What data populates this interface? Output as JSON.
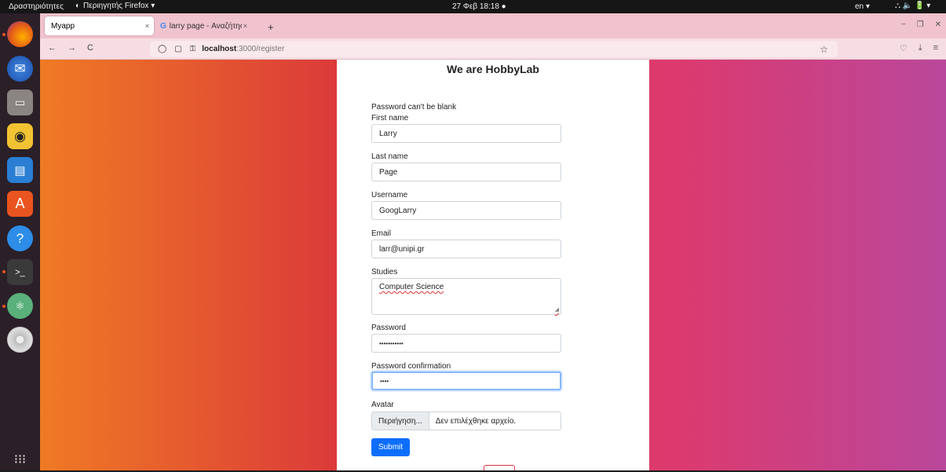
{
  "system_bar": {
    "activities": "Δραστηριότητες",
    "app_menu": "Περιηγητής Firefox ▾",
    "clock": "27 Φεβ 18:18 ●",
    "language": "en ▾",
    "tray": "⛬ 🔈 🔋 ▾"
  },
  "dock": {
    "items": [
      "firefox-icon",
      "thunderbird-icon",
      "files-icon",
      "rhythmbox-icon",
      "writer-icon",
      "software-center-icon",
      "help-icon",
      "terminal-icon",
      "atom-icon",
      "disc-icon",
      "app-grid-icon"
    ]
  },
  "browser": {
    "tabs": [
      {
        "label": "Myapp",
        "close": "×"
      },
      {
        "label": "larry page - Αναζήτηση G",
        "close": "×"
      }
    ],
    "new_tab": "+",
    "window_controls": [
      "−",
      "❐",
      "✕"
    ],
    "nav": {
      "back": "←",
      "forward": "→",
      "reload": "C"
    },
    "url": {
      "host": "localhost",
      "path": ":3000/register"
    },
    "star": "☆",
    "right_tools": [
      "♡",
      "⤓",
      "≡"
    ]
  },
  "page": {
    "title": "We are HobbyLab",
    "error": "Password can't be blank",
    "fields": {
      "first_name": {
        "label": "First name",
        "value": "Larry"
      },
      "last_name": {
        "label": "Last name",
        "value": "Page"
      },
      "username": {
        "label": "Username",
        "value": "GoogLarry"
      },
      "email": {
        "label": "Email",
        "value": "larr@unipi.gr"
      },
      "studies": {
        "label": "Studies",
        "value": "Computer Science"
      },
      "password": {
        "label": "Password",
        "value": "•••••••••••"
      },
      "password_confirmation": {
        "label": "Password confirmation",
        "value": "••••"
      },
      "avatar": {
        "label": "Avatar",
        "button": "Περιήγηση...",
        "filename": "Δεν επιλέχθηκε αρχείο."
      }
    },
    "submit_label": "Submit"
  },
  "colors": {
    "accent": "#0d6efd",
    "tab_bar": "#f0c3ce",
    "gradient": [
      "#ef7a24",
      "#db3a3a",
      "#dc3a6e",
      "#b9479a"
    ]
  }
}
